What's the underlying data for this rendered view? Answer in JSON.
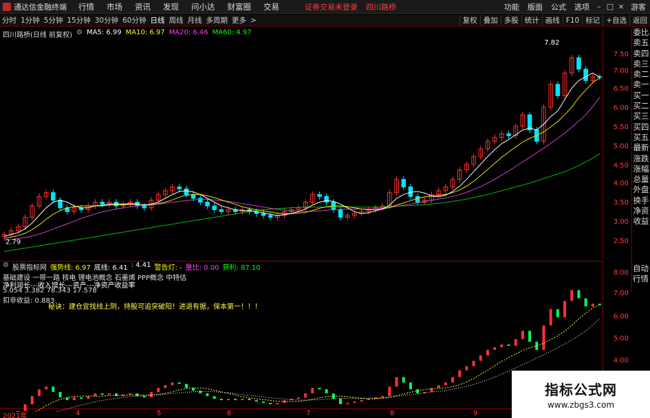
{
  "app": {
    "title": "通达信金融终端",
    "menus": [
      "行情",
      "市场",
      "资讯",
      "发现",
      "问小达",
      "财富圈",
      "交易"
    ],
    "notice": "证券交易未登录",
    "stock_name_top": "四川路桥",
    "right_menus": [
      "功能",
      "版面",
      "公式",
      "选项"
    ],
    "guest": "游客"
  },
  "toolbar": {
    "periods": [
      "分时",
      "1分钟",
      "5分钟",
      "15分钟",
      "30分钟",
      "60分钟",
      "日线",
      "周线",
      "月线",
      "多周期",
      "更多"
    ],
    "active_period": "日线",
    "right_buttons": [
      "复权",
      "叠加",
      "多股",
      "统计",
      "画线",
      "F10",
      "标记",
      "+自选",
      "返回"
    ]
  },
  "main_chart": {
    "title": "四川路桥(日线 前复权)",
    "ma": [
      {
        "label": "MA5: 6.99",
        "color": "#ffffff"
      },
      {
        "label": "MA10: 6.97",
        "color": "#ffff00"
      },
      {
        "label": "MA20: 6.46",
        "color": "#ff40ff"
      },
      {
        "label": "MA60: 4.97",
        "color": "#00ff00"
      }
    ],
    "price_ticks": [
      "7.50",
      "7.00",
      "6.50",
      "6.00",
      "5.50",
      "5.00",
      "4.50",
      "4.00",
      "3.50",
      "3.00",
      "2.50"
    ],
    "high_label": "7.82",
    "low_label": "2.79"
  },
  "side_panel": {
    "items": [
      "委比",
      "卖五",
      "卖四",
      "卖三",
      "卖二",
      "卖一",
      "买一",
      "买二",
      "买三",
      "买四",
      "买五",
      "最新",
      "涨跌",
      "涨幅",
      "总量",
      "外盘",
      "换手",
      "净资",
      "收益"
    ]
  },
  "sub_chart": {
    "indicator_name": "股票指标网",
    "fields": [
      {
        "label": "强势线: 6.97",
        "color": "#ffff00"
      },
      {
        "label": "底线: 6.41",
        "color": "#ffffff"
      },
      {
        "label": ": 4.41",
        "color": "#ffffff"
      },
      {
        "label": "警告灯: -",
        "color": "#ffff00"
      },
      {
        "label": "量比: 0.00",
        "color": "#ff40ff"
      },
      {
        "label": "获利: 87.10",
        "color": "#00ff00"
      }
    ],
    "ticks": [
      "8.00",
      "7.00",
      "6.00",
      "5.00",
      "4.00"
    ],
    "side_items": [
      "自动",
      "行情"
    ],
    "info_lines": [
      "基础建设 一带一路 核电 锂电池概念 石墨烯 PPP概念 中特估",
      "净利润长---收入增长---资产---净资产收益率",
      "5.054     3.382     78.343     17.578",
      "扣非收益: 0.883"
    ],
    "tip": "秘诀：建仓宜找线上阴，持股可追突破阳！进退有据，保本第一！！！"
  },
  "date_axis": {
    "labels": [
      "2021年",
      "4",
      "5",
      "6",
      "7",
      "8",
      "9"
    ]
  },
  "watermark": {
    "line1": "指标公式网",
    "line2": "www.zbgs3.com"
  },
  "chart_data": {
    "type": "candlestick",
    "title": "四川路桥(日线 前复权)",
    "ylim": [
      2.3,
      7.9
    ],
    "close": [
      2.85,
      2.95,
      3.05,
      3.3,
      3.6,
      3.85,
      3.95,
      3.75,
      3.55,
      3.45,
      3.55,
      3.5,
      3.6,
      3.7,
      3.65,
      3.7,
      3.6,
      3.65,
      3.7,
      3.6,
      3.55,
      3.75,
      3.9,
      4.0,
      4.1,
      4.05,
      3.9,
      3.8,
      3.7,
      3.6,
      3.5,
      3.45,
      3.5,
      3.45,
      3.5,
      3.45,
      3.4,
      3.35,
      3.3,
      3.35,
      3.45,
      3.5,
      3.55,
      3.7,
      3.9,
      3.85,
      3.7,
      3.5,
      3.3,
      3.35,
      3.4,
      3.45,
      3.5,
      3.55,
      3.6,
      3.95,
      4.3,
      4.1,
      3.85,
      3.7,
      3.75,
      3.9,
      4.0,
      4.1,
      4.3,
      4.55,
      4.7,
      4.9,
      5.1,
      5.3,
      5.4,
      5.5,
      5.45,
      5.7,
      6.0,
      5.6,
      5.3,
      6.2,
      6.8,
      6.5,
      7.1,
      7.5,
      7.2,
      6.9,
      7.0,
      6.99
    ],
    "ma5": [
      2.8,
      2.85,
      2.9,
      3.0,
      3.15,
      3.35,
      3.55,
      3.7,
      3.75,
      3.7,
      3.6,
      3.55,
      3.55,
      3.6,
      3.62,
      3.65,
      3.65,
      3.65,
      3.66,
      3.65,
      3.62,
      3.65,
      3.7,
      3.8,
      3.9,
      3.98,
      4.0,
      3.97,
      3.9,
      3.8,
      3.7,
      3.6,
      3.55,
      3.5,
      3.48,
      3.47,
      3.45,
      3.42,
      3.38,
      3.35,
      3.37,
      3.4,
      3.45,
      3.52,
      3.62,
      3.7,
      3.74,
      3.72,
      3.65,
      3.55,
      3.45,
      3.4,
      3.42,
      3.47,
      3.52,
      3.62,
      3.8,
      3.9,
      3.96,
      3.98,
      3.94,
      3.86,
      3.84,
      3.88,
      3.98,
      4.12,
      4.3,
      4.5,
      4.7,
      4.9,
      5.08,
      5.24,
      5.35,
      5.47,
      5.6,
      5.65,
      5.6,
      5.75,
      5.95,
      6.1,
      6.4,
      6.7,
      6.9,
      7.0,
      7.1,
      6.99
    ],
    "ma10": [
      2.75,
      2.78,
      2.82,
      2.88,
      2.98,
      3.1,
      3.25,
      3.38,
      3.48,
      3.55,
      3.58,
      3.6,
      3.6,
      3.6,
      3.6,
      3.62,
      3.63,
      3.63,
      3.64,
      3.64,
      3.63,
      3.64,
      3.66,
      3.7,
      3.76,
      3.83,
      3.88,
      3.9,
      3.9,
      3.87,
      3.82,
      3.76,
      3.7,
      3.64,
      3.58,
      3.53,
      3.5,
      3.47,
      3.44,
      3.41,
      3.4,
      3.4,
      3.41,
      3.43,
      3.48,
      3.54,
      3.58,
      3.6,
      3.6,
      3.58,
      3.55,
      3.52,
      3.5,
      3.5,
      3.52,
      3.56,
      3.62,
      3.68,
      3.74,
      3.8,
      3.84,
      3.86,
      3.88,
      3.9,
      3.95,
      4.02,
      4.12,
      4.25,
      4.4,
      4.56,
      4.72,
      4.88,
      5.02,
      5.15,
      5.28,
      5.38,
      5.45,
      5.55,
      5.68,
      5.82,
      6.0,
      6.2,
      6.45,
      6.65,
      6.85,
      6.97
    ],
    "ma20": [
      2.7,
      2.72,
      2.74,
      2.77,
      2.81,
      2.86,
      2.92,
      2.99,
      3.06,
      3.13,
      3.2,
      3.27,
      3.33,
      3.39,
      3.44,
      3.48,
      3.52,
      3.55,
      3.58,
      3.6,
      3.61,
      3.63,
      3.65,
      3.67,
      3.7,
      3.72,
      3.74,
      3.76,
      3.77,
      3.77,
      3.76,
      3.74,
      3.72,
      3.69,
      3.66,
      3.63,
      3.6,
      3.57,
      3.54,
      3.51,
      3.49,
      3.47,
      3.46,
      3.45,
      3.46,
      3.47,
      3.49,
      3.5,
      3.51,
      3.52,
      3.52,
      3.52,
      3.52,
      3.53,
      3.54,
      3.56,
      3.59,
      3.62,
      3.65,
      3.68,
      3.72,
      3.75,
      3.78,
      3.81,
      3.85,
      3.9,
      3.96,
      4.03,
      4.11,
      4.2,
      4.3,
      4.41,
      4.52,
      4.64,
      4.76,
      4.88,
      5.0,
      5.12,
      5.25,
      5.38,
      5.52,
      5.67,
      5.83,
      6.0,
      6.22,
      6.46
    ],
    "ma60": [
      2.4,
      2.43,
      2.46,
      2.49,
      2.52,
      2.55,
      2.58,
      2.61,
      2.64,
      2.67,
      2.7,
      2.73,
      2.76,
      2.79,
      2.82,
      2.85,
      2.88,
      2.91,
      2.94,
      2.97,
      3.0,
      3.03,
      3.06,
      3.09,
      3.12,
      3.15,
      3.18,
      3.21,
      3.24,
      3.27,
      3.3,
      3.33,
      3.36,
      3.39,
      3.42,
      3.45,
      3.48,
      3.5,
      3.52,
      3.53,
      3.54,
      3.55,
      3.56,
      3.57,
      3.57,
      3.57,
      3.57,
      3.57,
      3.57,
      3.57,
      3.57,
      3.57,
      3.57,
      3.57,
      3.57,
      3.58,
      3.59,
      3.6,
      3.61,
      3.62,
      3.63,
      3.65,
      3.67,
      3.69,
      3.72,
      3.75,
      3.78,
      3.82,
      3.86,
      3.9,
      3.95,
      4.0,
      4.05,
      4.1,
      4.15,
      4.2,
      4.26,
      4.32,
      4.38,
      4.44,
      4.5,
      4.58,
      4.66,
      4.76,
      4.86,
      4.97
    ]
  }
}
